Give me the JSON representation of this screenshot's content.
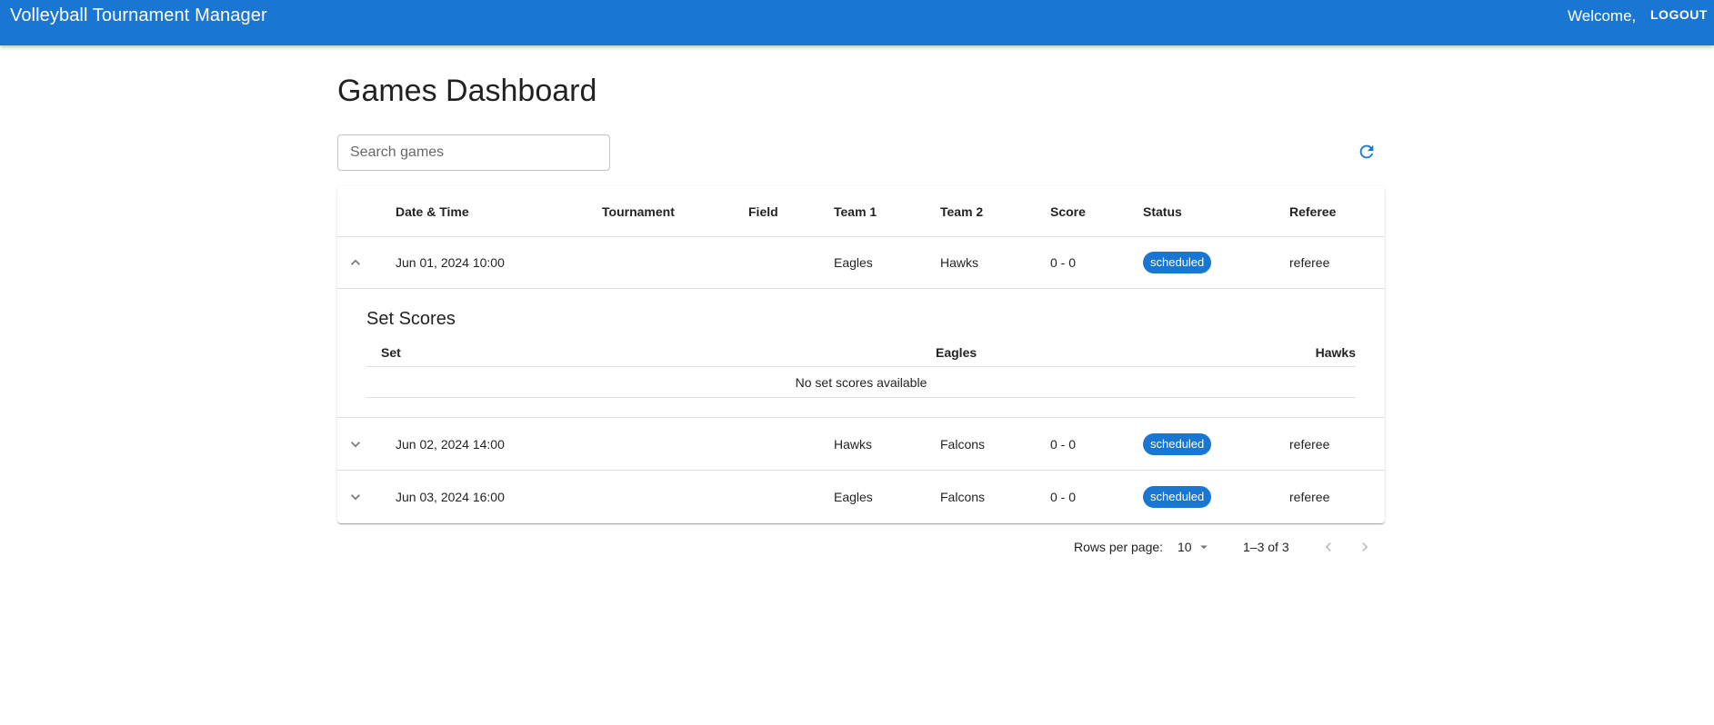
{
  "appbar": {
    "title": "Volleyball Tournament Manager",
    "welcome": "Welcome,",
    "logout_label": "LOGOUT"
  },
  "page": {
    "title": "Games Dashboard"
  },
  "search": {
    "placeholder": "Search games",
    "value": ""
  },
  "icons": {
    "refresh": "refresh-icon",
    "expand": "chevron-up-icon",
    "collapse": "chevron-down-icon",
    "rows_dropdown": "caret-down-icon",
    "prev": "chevron-left-icon",
    "next": "chevron-right-icon"
  },
  "colors": {
    "primary": "#1976d2",
    "chip_text": "#ffffff",
    "divider": "#e0e0e0"
  },
  "table": {
    "headers": {
      "date_time": "Date & Time",
      "tournament": "Tournament",
      "field": "Field",
      "team1": "Team 1",
      "team2": "Team 2",
      "score": "Score",
      "status": "Status",
      "referee": "Referee"
    },
    "rows": [
      {
        "date_time": "Jun 01, 2024 10:00",
        "tournament": "",
        "field": "",
        "team1": "Eagles",
        "team2": "Hawks",
        "score": "0 - 0",
        "status": "scheduled",
        "referee": "referee",
        "expanded": true
      },
      {
        "date_time": "Jun 02, 2024 14:00",
        "tournament": "",
        "field": "",
        "team1": "Hawks",
        "team2": "Falcons",
        "score": "0 - 0",
        "status": "scheduled",
        "referee": "referee",
        "expanded": false
      },
      {
        "date_time": "Jun 03, 2024 16:00",
        "tournament": "",
        "field": "",
        "team1": "Eagles",
        "team2": "Falcons",
        "score": "0 - 0",
        "status": "scheduled",
        "referee": "referee",
        "expanded": false
      }
    ],
    "set_scores": {
      "title": "Set Scores",
      "col_set": "Set",
      "col_team1": "Eagles",
      "col_team2": "Hawks",
      "empty_message": "No set scores available"
    }
  },
  "pagination": {
    "rows_per_page_label": "Rows per page:",
    "rows_per_page_value": "10",
    "range": "1–3 of 3"
  }
}
